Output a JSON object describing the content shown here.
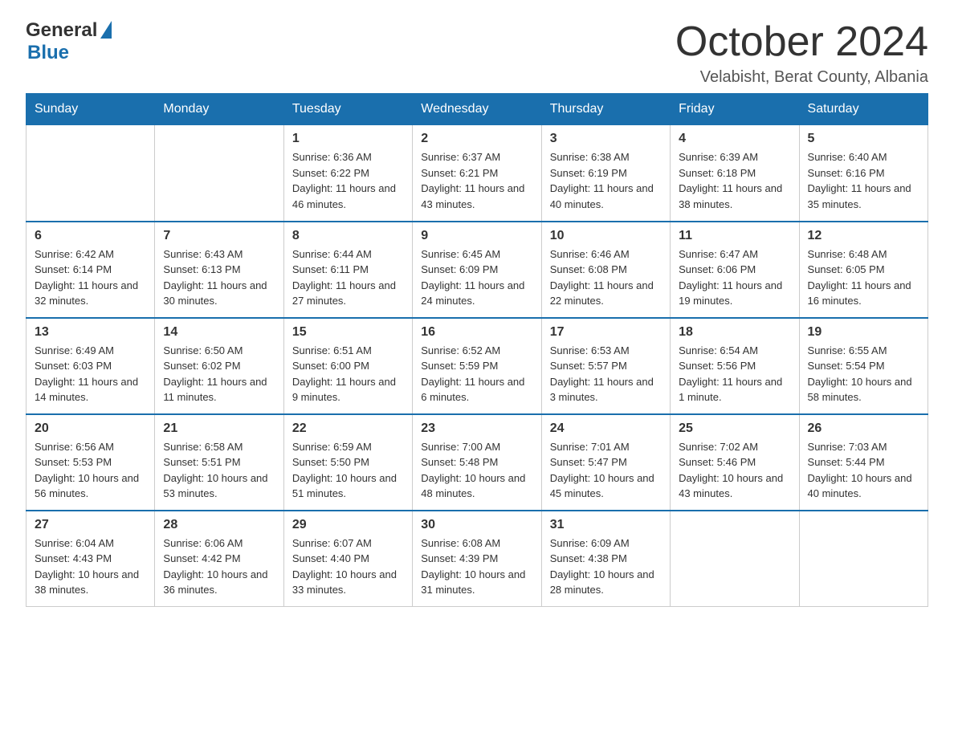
{
  "logo": {
    "general": "General",
    "blue": "Blue",
    "triangle": "▶"
  },
  "header": {
    "month": "October 2024",
    "location": "Velabisht, Berat County, Albania"
  },
  "days_of_week": [
    "Sunday",
    "Monday",
    "Tuesday",
    "Wednesday",
    "Thursday",
    "Friday",
    "Saturday"
  ],
  "weeks": [
    [
      {
        "day": "",
        "sunrise": "",
        "sunset": "",
        "daylight": ""
      },
      {
        "day": "",
        "sunrise": "",
        "sunset": "",
        "daylight": ""
      },
      {
        "day": "1",
        "sunrise": "Sunrise: 6:36 AM",
        "sunset": "Sunset: 6:22 PM",
        "daylight": "Daylight: 11 hours and 46 minutes."
      },
      {
        "day": "2",
        "sunrise": "Sunrise: 6:37 AM",
        "sunset": "Sunset: 6:21 PM",
        "daylight": "Daylight: 11 hours and 43 minutes."
      },
      {
        "day": "3",
        "sunrise": "Sunrise: 6:38 AM",
        "sunset": "Sunset: 6:19 PM",
        "daylight": "Daylight: 11 hours and 40 minutes."
      },
      {
        "day": "4",
        "sunrise": "Sunrise: 6:39 AM",
        "sunset": "Sunset: 6:18 PM",
        "daylight": "Daylight: 11 hours and 38 minutes."
      },
      {
        "day": "5",
        "sunrise": "Sunrise: 6:40 AM",
        "sunset": "Sunset: 6:16 PM",
        "daylight": "Daylight: 11 hours and 35 minutes."
      }
    ],
    [
      {
        "day": "6",
        "sunrise": "Sunrise: 6:42 AM",
        "sunset": "Sunset: 6:14 PM",
        "daylight": "Daylight: 11 hours and 32 minutes."
      },
      {
        "day": "7",
        "sunrise": "Sunrise: 6:43 AM",
        "sunset": "Sunset: 6:13 PM",
        "daylight": "Daylight: 11 hours and 30 minutes."
      },
      {
        "day": "8",
        "sunrise": "Sunrise: 6:44 AM",
        "sunset": "Sunset: 6:11 PM",
        "daylight": "Daylight: 11 hours and 27 minutes."
      },
      {
        "day": "9",
        "sunrise": "Sunrise: 6:45 AM",
        "sunset": "Sunset: 6:09 PM",
        "daylight": "Daylight: 11 hours and 24 minutes."
      },
      {
        "day": "10",
        "sunrise": "Sunrise: 6:46 AM",
        "sunset": "Sunset: 6:08 PM",
        "daylight": "Daylight: 11 hours and 22 minutes."
      },
      {
        "day": "11",
        "sunrise": "Sunrise: 6:47 AM",
        "sunset": "Sunset: 6:06 PM",
        "daylight": "Daylight: 11 hours and 19 minutes."
      },
      {
        "day": "12",
        "sunrise": "Sunrise: 6:48 AM",
        "sunset": "Sunset: 6:05 PM",
        "daylight": "Daylight: 11 hours and 16 minutes."
      }
    ],
    [
      {
        "day": "13",
        "sunrise": "Sunrise: 6:49 AM",
        "sunset": "Sunset: 6:03 PM",
        "daylight": "Daylight: 11 hours and 14 minutes."
      },
      {
        "day": "14",
        "sunrise": "Sunrise: 6:50 AM",
        "sunset": "Sunset: 6:02 PM",
        "daylight": "Daylight: 11 hours and 11 minutes."
      },
      {
        "day": "15",
        "sunrise": "Sunrise: 6:51 AM",
        "sunset": "Sunset: 6:00 PM",
        "daylight": "Daylight: 11 hours and 9 minutes."
      },
      {
        "day": "16",
        "sunrise": "Sunrise: 6:52 AM",
        "sunset": "Sunset: 5:59 PM",
        "daylight": "Daylight: 11 hours and 6 minutes."
      },
      {
        "day": "17",
        "sunrise": "Sunrise: 6:53 AM",
        "sunset": "Sunset: 5:57 PM",
        "daylight": "Daylight: 11 hours and 3 minutes."
      },
      {
        "day": "18",
        "sunrise": "Sunrise: 6:54 AM",
        "sunset": "Sunset: 5:56 PM",
        "daylight": "Daylight: 11 hours and 1 minute."
      },
      {
        "day": "19",
        "sunrise": "Sunrise: 6:55 AM",
        "sunset": "Sunset: 5:54 PM",
        "daylight": "Daylight: 10 hours and 58 minutes."
      }
    ],
    [
      {
        "day": "20",
        "sunrise": "Sunrise: 6:56 AM",
        "sunset": "Sunset: 5:53 PM",
        "daylight": "Daylight: 10 hours and 56 minutes."
      },
      {
        "day": "21",
        "sunrise": "Sunrise: 6:58 AM",
        "sunset": "Sunset: 5:51 PM",
        "daylight": "Daylight: 10 hours and 53 minutes."
      },
      {
        "day": "22",
        "sunrise": "Sunrise: 6:59 AM",
        "sunset": "Sunset: 5:50 PM",
        "daylight": "Daylight: 10 hours and 51 minutes."
      },
      {
        "day": "23",
        "sunrise": "Sunrise: 7:00 AM",
        "sunset": "Sunset: 5:48 PM",
        "daylight": "Daylight: 10 hours and 48 minutes."
      },
      {
        "day": "24",
        "sunrise": "Sunrise: 7:01 AM",
        "sunset": "Sunset: 5:47 PM",
        "daylight": "Daylight: 10 hours and 45 minutes."
      },
      {
        "day": "25",
        "sunrise": "Sunrise: 7:02 AM",
        "sunset": "Sunset: 5:46 PM",
        "daylight": "Daylight: 10 hours and 43 minutes."
      },
      {
        "day": "26",
        "sunrise": "Sunrise: 7:03 AM",
        "sunset": "Sunset: 5:44 PM",
        "daylight": "Daylight: 10 hours and 40 minutes."
      }
    ],
    [
      {
        "day": "27",
        "sunrise": "Sunrise: 6:04 AM",
        "sunset": "Sunset: 4:43 PM",
        "daylight": "Daylight: 10 hours and 38 minutes."
      },
      {
        "day": "28",
        "sunrise": "Sunrise: 6:06 AM",
        "sunset": "Sunset: 4:42 PM",
        "daylight": "Daylight: 10 hours and 36 minutes."
      },
      {
        "day": "29",
        "sunrise": "Sunrise: 6:07 AM",
        "sunset": "Sunset: 4:40 PM",
        "daylight": "Daylight: 10 hours and 33 minutes."
      },
      {
        "day": "30",
        "sunrise": "Sunrise: 6:08 AM",
        "sunset": "Sunset: 4:39 PM",
        "daylight": "Daylight: 10 hours and 31 minutes."
      },
      {
        "day": "31",
        "sunrise": "Sunrise: 6:09 AM",
        "sunset": "Sunset: 4:38 PM",
        "daylight": "Daylight: 10 hours and 28 minutes."
      },
      {
        "day": "",
        "sunrise": "",
        "sunset": "",
        "daylight": ""
      },
      {
        "day": "",
        "sunrise": "",
        "sunset": "",
        "daylight": ""
      }
    ]
  ]
}
